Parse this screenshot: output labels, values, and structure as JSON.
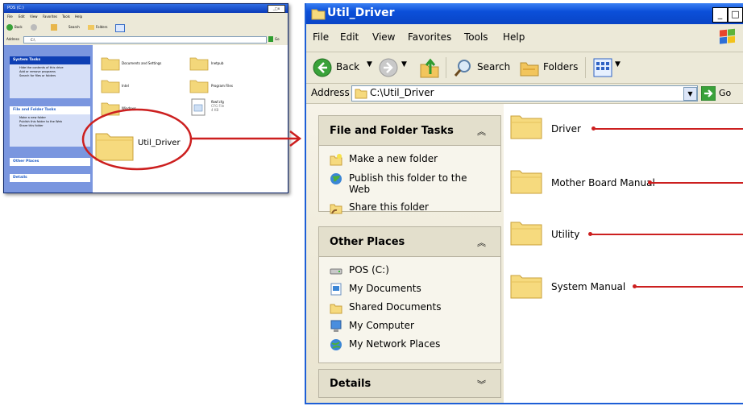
{
  "small_window": {
    "title": "POS (C:)",
    "menu": [
      "File",
      "Edit",
      "View",
      "Favorites",
      "Tools",
      "Help"
    ],
    "toolbar": {
      "back": "Back",
      "search": "Search",
      "folders": "Folders"
    },
    "address_label": "Address",
    "address_value": "C:\\",
    "go": "Go",
    "system_tasks": {
      "title": "System Tasks",
      "items": [
        "Hide the contents of this drive",
        "Add or remove programs",
        "Search for files or folders"
      ]
    },
    "file_folder_tasks": {
      "title": "File and Folder Tasks",
      "items": [
        "Make a new folder",
        "Publish this folder to the Web",
        "Share this folder"
      ]
    },
    "other_places": "Other Places",
    "details": "Details",
    "files": [
      {
        "name": "Documents and Settings"
      },
      {
        "name": "Inetpub"
      },
      {
        "name": "Intel"
      },
      {
        "name": "Program Files"
      },
      {
        "name": "Windows"
      },
      {
        "name": "fbwf.cfg",
        "type": "CFG File",
        "size": "4 KB"
      }
    ],
    "highlighted_folder": "Util_Driver"
  },
  "big_window": {
    "title": "Util_Driver",
    "menu": [
      "File",
      "Edit",
      "View",
      "Favorites",
      "Tools",
      "Help"
    ],
    "toolbar": {
      "back": "Back",
      "search": "Search",
      "folders": "Folders"
    },
    "address_label": "Address",
    "address_value": "C:\\Util_Driver",
    "go": "Go",
    "file_folder_tasks": {
      "title": "File and Folder Tasks",
      "items": [
        "Make a new folder",
        "Publish this folder to the Web",
        "Share this folder"
      ]
    },
    "other_places": {
      "title": "Other Places",
      "items": [
        "POS (C:)",
        "My Documents",
        "Shared Documents",
        "My Computer",
        "My Network Places"
      ]
    },
    "details": "Details",
    "folders": [
      "Driver",
      "Mother Board Manual",
      "Utility",
      "System Manual"
    ]
  },
  "colors": {
    "annotation_red": "#cc1f1f",
    "xp_blue": "#0a45c6",
    "task_pane_blue": "#7a96df"
  }
}
